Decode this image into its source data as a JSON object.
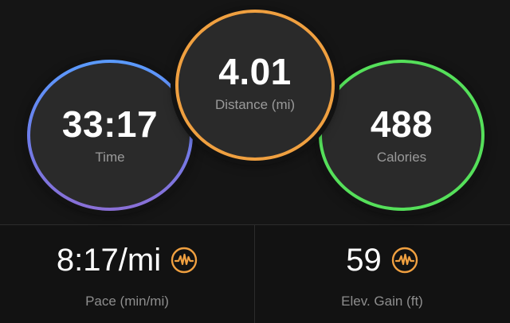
{
  "rings": {
    "time": {
      "value": "33:17",
      "label": "Time",
      "color": "#6f7be8"
    },
    "distance": {
      "value": "4.01",
      "label": "Distance (mi)",
      "color": "#f0a040"
    },
    "calories": {
      "value": "488",
      "label": "Calories",
      "color": "#55e05a"
    }
  },
  "stats": {
    "pace": {
      "value": "8:17/mi",
      "label": "Pace (min/mi)",
      "icon": "pulse-icon"
    },
    "elevation": {
      "value": "59",
      "label": "Elev. Gain (ft)",
      "icon": "pulse-icon"
    }
  },
  "colors": {
    "background": "#121212",
    "icon_accent": "#f0a040"
  }
}
